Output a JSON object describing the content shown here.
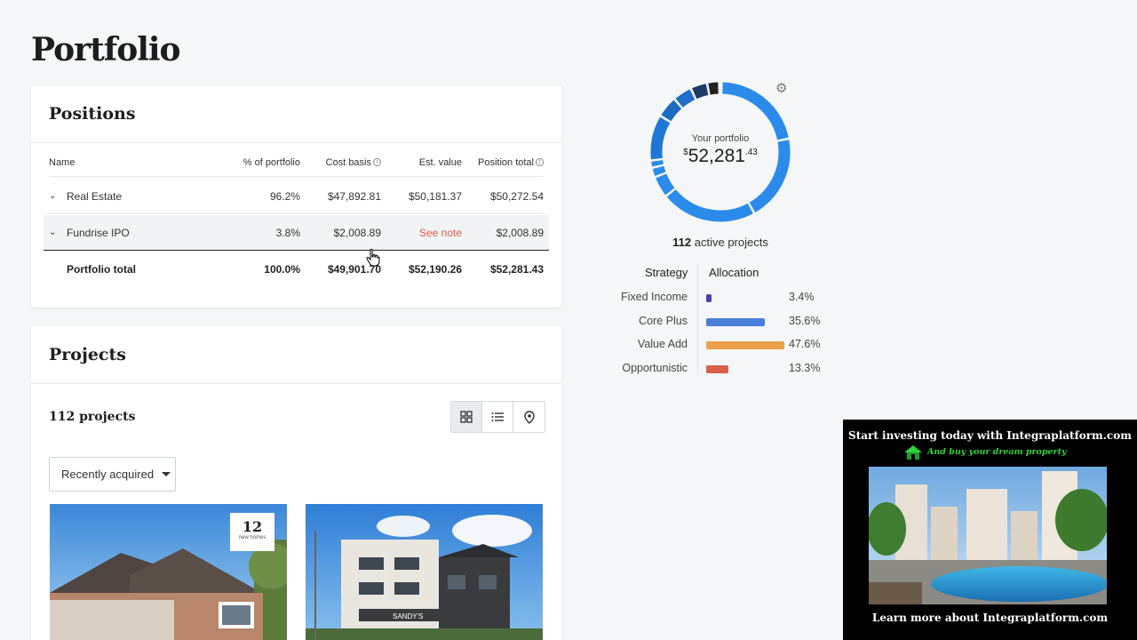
{
  "page": {
    "title": "Portfolio"
  },
  "positions": {
    "title": "Positions",
    "columns": {
      "name": "Name",
      "pct": "% of portfolio",
      "cost": "Cost basis",
      "est": "Est. value",
      "total": "Position total"
    },
    "rows": [
      {
        "name": "Real Estate",
        "pct": "96.2%",
        "cost": "$47,892.81",
        "est": "$50,181.37",
        "total": "$50,272.54"
      },
      {
        "name": "Fundrise IPO",
        "pct": "3.8%",
        "cost": "$2,008.89",
        "est": "See note",
        "total": "$2,008.89"
      }
    ],
    "total": {
      "name": "Portfolio total",
      "pct": "100.0%",
      "cost": "$49,901.70",
      "est": "$52,190.26",
      "total": "$52,281.43"
    }
  },
  "projects": {
    "title": "Projects",
    "count": "112 projects",
    "sort": "Recently acquired",
    "cards": [
      {
        "badge_number": "12",
        "badge_label": "new homes"
      },
      {
        "sign": "SANDY'S"
      }
    ]
  },
  "summary": {
    "label": "Your portfolio",
    "currency": "$",
    "value_whole": "52,281",
    "value_cents": ".43",
    "active_count": "112",
    "active_label": "active projects"
  },
  "allocation": {
    "strategy_header": "Strategy",
    "allocation_header": "Allocation",
    "rows": [
      {
        "label": "Fixed Income",
        "pct": "3.4%",
        "value": 3.4,
        "color": "#4a3fb0"
      },
      {
        "label": "Core Plus",
        "pct": "35.6%",
        "value": 35.6,
        "color": "#4a7fd9"
      },
      {
        "label": "Value Add",
        "pct": "47.6%",
        "value": 47.6,
        "color": "#eda04c"
      },
      {
        "label": "Opportunistic",
        "pct": "13.3%",
        "value": 13.3,
        "color": "#d9604a"
      }
    ]
  },
  "ad": {
    "headline": "Start investing today with Integraplatform.com",
    "subline": "And buy your dream property",
    "footer": "Learn more about Integraplatform.com"
  },
  "icons": {
    "settings": "gear-icon",
    "grid": "grid-view-icon",
    "list": "list-view-icon",
    "map": "map-pin-icon",
    "expand": "chevron-down-icon",
    "info": "info-icon"
  }
}
